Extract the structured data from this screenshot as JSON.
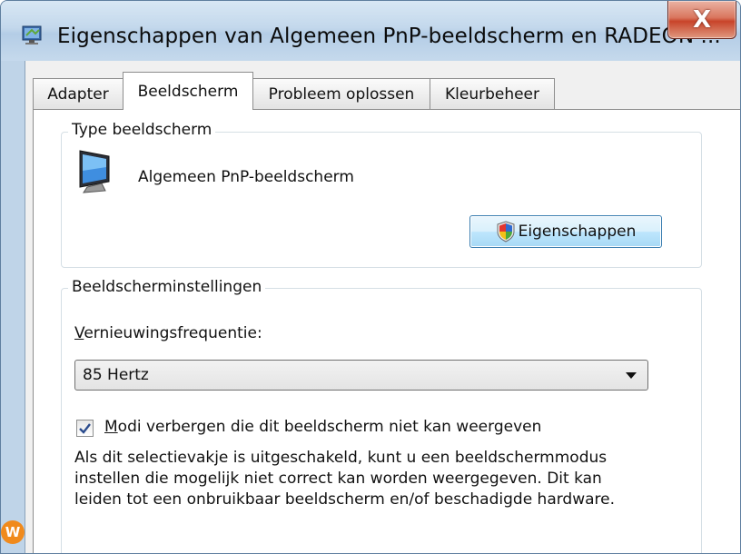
{
  "window": {
    "title": "Eigenschappen van Algemeen PnP-beeldscherm en RADEON ...",
    "close_label": "X"
  },
  "tabs": [
    {
      "label": "Adapter",
      "active": false
    },
    {
      "label": "Beeldscherm",
      "active": true
    },
    {
      "label": "Probleem oplossen",
      "active": false
    },
    {
      "label": "Kleurbeheer",
      "active": false
    }
  ],
  "monitor_type": {
    "legend": "Type beeldscherm",
    "device_name": "Algemeen PnP-beeldscherm",
    "properties_button": "Eigenschappen"
  },
  "settings": {
    "legend": "Beeldscherminstellingen",
    "refresh_label_accel": "V",
    "refresh_label_rest": "ernieuwingsfrequentie:",
    "refresh_value": "85 Hertz",
    "hide_modes_checked": true,
    "hide_modes_accel": "M",
    "hide_modes_rest": "odi verbergen die dit beeldscherm niet kan weergeven",
    "description_lines": [
      "Als dit selectievakje is uitgeschakeld, kunt u een beeldschermmodus",
      "instellen die mogelijk niet correct kan worden weergegeven. Dit kan",
      "leiden tot een onbruikbaar beeldscherm en/of beschadigde hardware."
    ]
  },
  "icons": {
    "title": "display-properties-icon",
    "monitor": "monitor-icon",
    "button": "uac-shield-icon",
    "check": "checkmark-icon",
    "watermark": "w-logo-icon"
  },
  "watermark_letter": "W"
}
